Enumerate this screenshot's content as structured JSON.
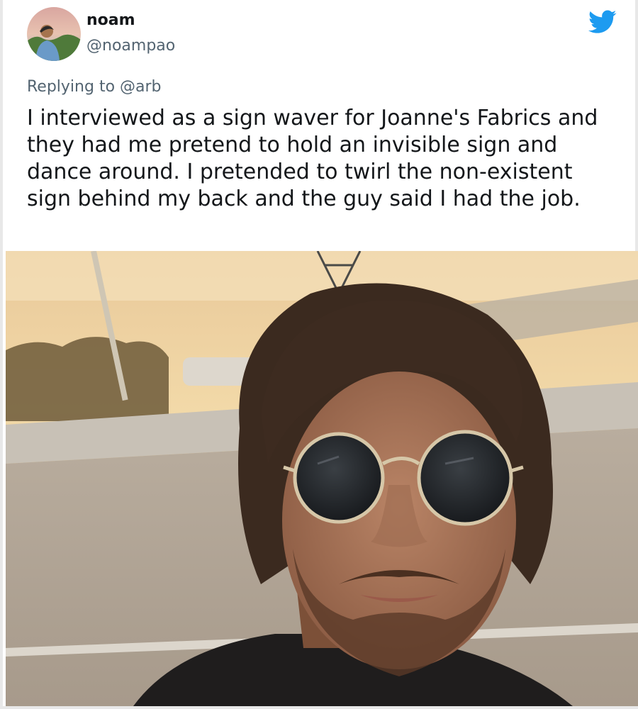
{
  "tweet": {
    "display_name": "noam",
    "handle": "@noampao",
    "replying_prefix": "Replying to ",
    "replying_to": "@arb",
    "text": "I interviewed as a sign waver for Joanne's Fabrics and they had me pretend to hold an invisible sign and dance around. I pretended to twirl the non-existent sign behind my back and the guy said I had the job."
  },
  "icons": {
    "platform": "twitter-bird-icon"
  },
  "colors": {
    "twitter_blue": "#1d9bf0",
    "secondary_text": "#536471",
    "primary_text": "#14171a"
  }
}
